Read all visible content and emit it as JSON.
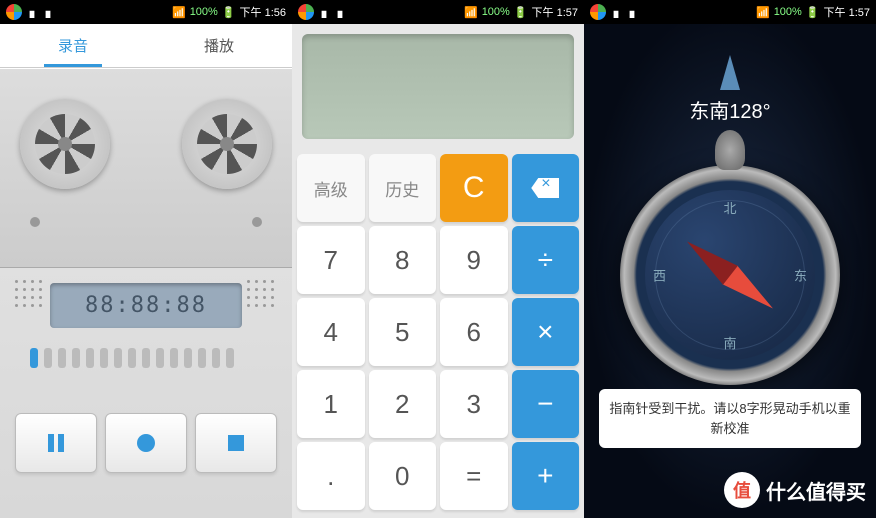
{
  "statusbar": {
    "signal": "100%",
    "time1": "下午 1:56",
    "time2": "下午 1:57",
    "time3": "下午 1:57"
  },
  "recorder": {
    "tabs": {
      "record": "录音",
      "play": "播放"
    },
    "timer": "88:88:88"
  },
  "calc": {
    "keys": {
      "adv": "高级",
      "hist": "历史",
      "clear": "C",
      "k7": "7",
      "k8": "8",
      "k9": "9",
      "div": "÷",
      "k4": "4",
      "k5": "5",
      "k6": "6",
      "mul": "×",
      "k1": "1",
      "k2": "2",
      "k3": "3",
      "sub": "−",
      "dot": ".",
      "k0": "0",
      "eq": "=",
      "add": "+"
    }
  },
  "compass": {
    "heading": "东南128°",
    "n": "北",
    "s": "南",
    "e": "东",
    "w": "西",
    "alert": "指南针受到干扰。请以8字形晃动手机以重新校准"
  },
  "watermark": {
    "badge": "值",
    "text": "什么值得买"
  }
}
